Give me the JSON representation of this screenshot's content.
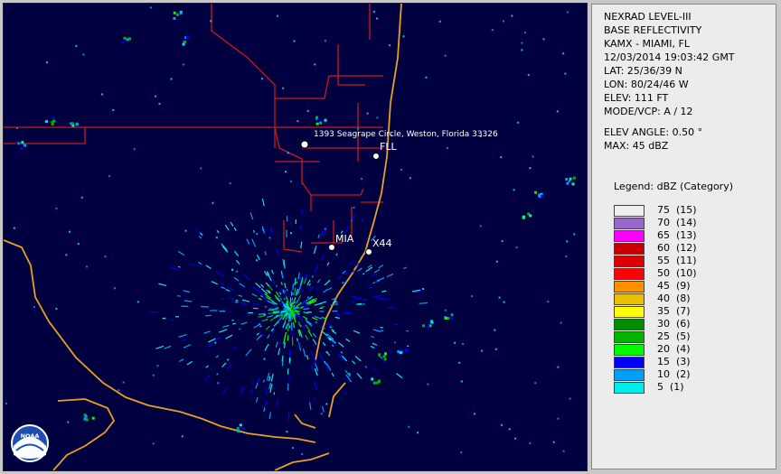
{
  "map": {
    "address_label": "1393 Seagrape Circle, Weston, Florida 33326",
    "stations": [
      {
        "label": "FLL"
      },
      {
        "label": "MIA"
      },
      {
        "label": "X44"
      }
    ],
    "logo_text": "NOAA"
  },
  "info": {
    "product": "NEXRAD LEVEL-III",
    "product_type": "BASE REFLECTIVITY",
    "site": "KAMX - MIAMI, FL",
    "datetime": "12/03/2014 19:03:42 GMT",
    "lat": "LAT: 25/36/39 N",
    "lon": "LON: 80/24/46 W",
    "elev": "ELEV: 111 FT",
    "mode": "MODE/VCP: A / 12",
    "elev_angle": "ELEV ANGLE: 0.50 °",
    "max": "MAX: 45 dBZ"
  },
  "legend": {
    "title": "Legend: dBZ (Category)",
    "items": [
      {
        "label": "75  (15)",
        "color": "#eeeeee"
      },
      {
        "label": "70  (14)",
        "color": "#9966cc"
      },
      {
        "label": "65  (13)",
        "color": "#ff00ff"
      },
      {
        "label": "60  (12)",
        "color": "#c80000"
      },
      {
        "label": "55  (11)",
        "color": "#dd0000"
      },
      {
        "label": "50  (10)",
        "color": "#ff0000"
      },
      {
        "label": "45  (9)",
        "color": "#ff9000"
      },
      {
        "label": "40  (8)",
        "color": "#e8c000"
      },
      {
        "label": "35  (7)",
        "color": "#ffff00"
      },
      {
        "label": "30  (6)",
        "color": "#008c00"
      },
      {
        "label": "25  (5)",
        "color": "#00b400"
      },
      {
        "label": "20  (4)",
        "color": "#00fa00"
      },
      {
        "label": "15  (3)",
        "color": "#0000f6"
      },
      {
        "label": "10  (2)",
        "color": "#01a0f6"
      },
      {
        "label": "5  (1)",
        "color": "#00ecec"
      }
    ]
  }
}
